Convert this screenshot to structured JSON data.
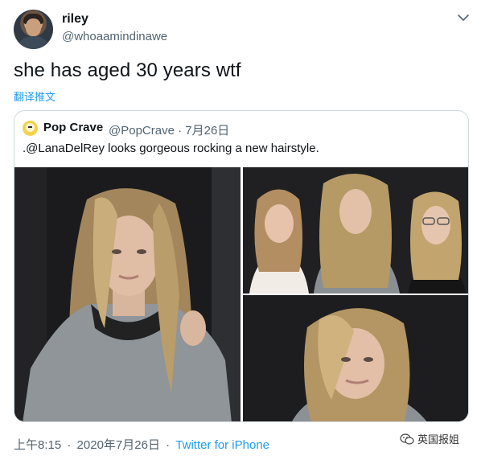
{
  "author": {
    "name": "riley",
    "handle": "@whoaamindinawe"
  },
  "tweet": {
    "text": "she has aged 30 years wtf",
    "translate_label": "翻译推文"
  },
  "quoted": {
    "name": "Pop Crave",
    "handle_date": "@PopCrave · 7月26日",
    "text": ".@LanaDelRey looks gorgeous rocking a new hairstyle."
  },
  "footer": {
    "time": "上午8:15",
    "date": "2020年7月26日",
    "separator": "·",
    "source": "Twitter for iPhone"
  },
  "watermark": {
    "text": "英国报姐",
    "icon": "wechat-icon"
  },
  "icons": {
    "caret": "chevron-down-icon"
  },
  "colors": {
    "link": "#1d9bf0",
    "secondary_text": "#536471",
    "border": "#cfd9de"
  }
}
